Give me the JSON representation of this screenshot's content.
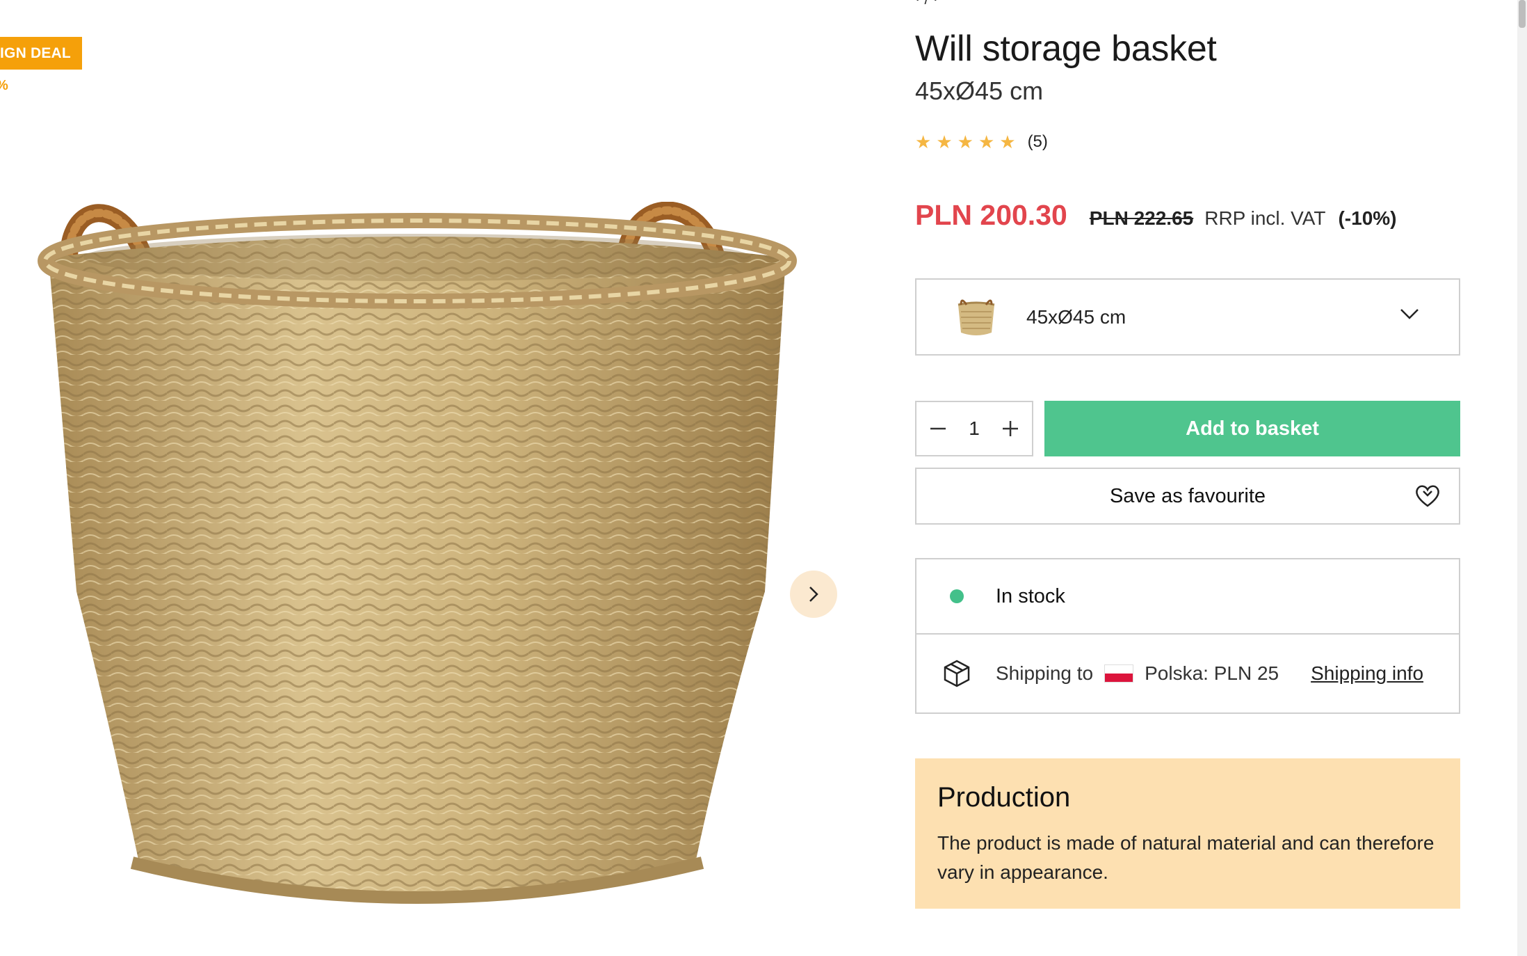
{
  "gallery": {
    "deal_badge": "IGN DEAL",
    "deal_pct": "%",
    "image_alt": "Will storage basket"
  },
  "breadcrumb_fragment": "·  /   ·",
  "product": {
    "title": "Will storage basket",
    "size": "45xØ45 cm",
    "rating": {
      "stars": 5,
      "count_label": "(5)"
    },
    "price": {
      "current": "PLN 200.30",
      "original": "PLN 222.65",
      "rrp_label": "RRP incl. VAT",
      "discount": "(-10%)"
    },
    "variant": {
      "selected": "45xØ45 cm"
    },
    "quantity": "1",
    "add_to_basket": "Add to basket",
    "save_favourite": "Save as favourite",
    "stock": "In stock",
    "shipping": {
      "label": "Shipping to",
      "destination": "Polska: PLN 25",
      "info_link": "Shipping info"
    },
    "production": {
      "heading": "Production",
      "text": "The product is made of natural material and can therefore vary in appearance."
    }
  },
  "colors": {
    "sale_price": "#e2454d",
    "add_button": "#4fc58e",
    "stock_dot": "#43c08a",
    "deal_badge": "#f5a00a",
    "production_bg": "#fde0b1",
    "star": "#f5b642"
  },
  "icons": [
    "chevron-right-icon",
    "chevron-down-icon",
    "minus-icon",
    "plus-icon",
    "heart-icon",
    "box-icon",
    "poland-flag-icon",
    "star-icon"
  ]
}
